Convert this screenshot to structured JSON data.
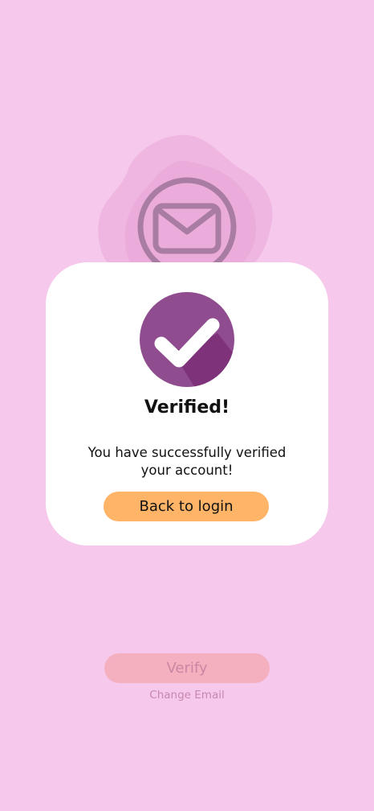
{
  "dialog": {
    "title": "Verified!",
    "message_line1": "You have successfully verified",
    "message_line2": "your account!",
    "back_button_label": "Back to login",
    "icon": "checkmark-icon"
  },
  "background": {
    "icon": "envelope-icon",
    "verify_button_label": "Verify",
    "change_email_label": "Change Email"
  },
  "colors": {
    "page_background": "#f5c8ec",
    "dialog_background": "#ffffff",
    "accent_purple": "#8a3d84",
    "primary_button": "#ffb468",
    "disabled_button": "#f5b0c0",
    "link_text": "#c788ad"
  }
}
